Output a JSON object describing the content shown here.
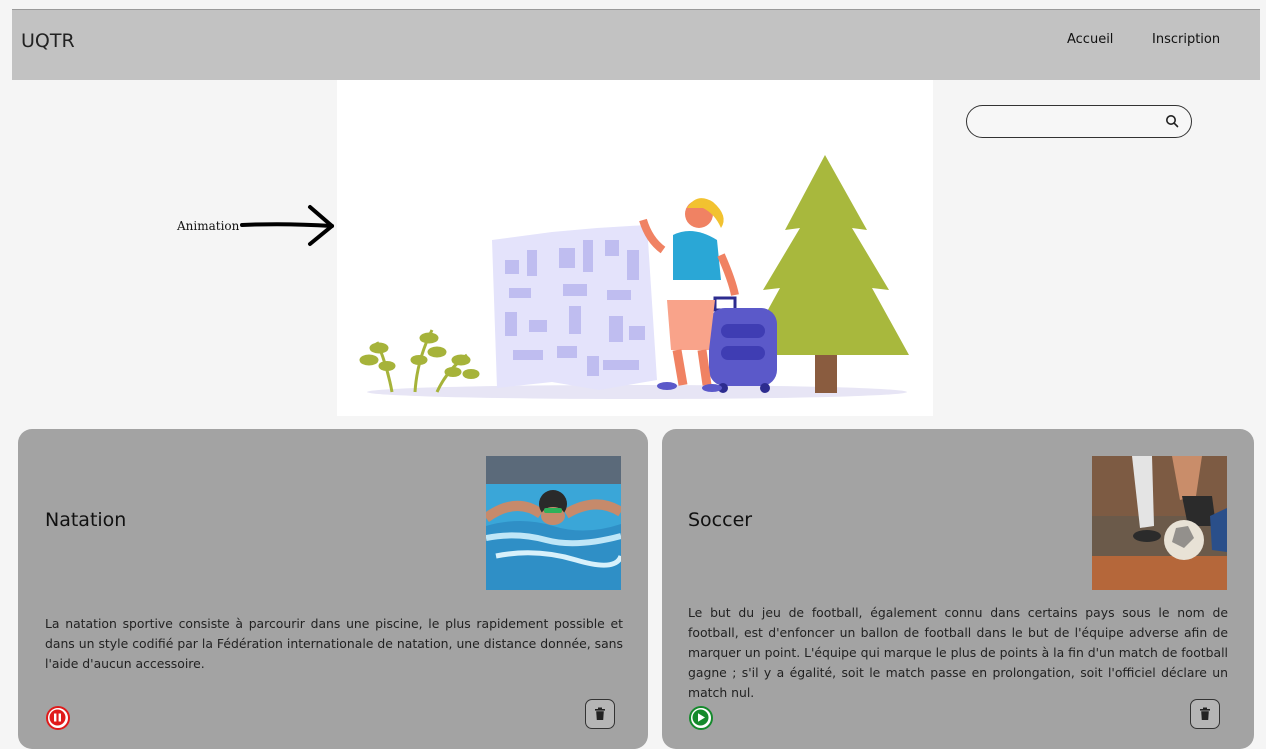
{
  "navbar": {
    "brand": "UQTR",
    "links": [
      "Accueil",
      "Inscription"
    ]
  },
  "annotation": {
    "label": "Animation"
  },
  "search": {
    "value": "",
    "placeholder": ""
  },
  "cards": [
    {
      "title": "Natation",
      "description": "La natation sportive consiste à parcourir dans une piscine, le plus rapidement possible et dans un style codifié par la Fédération internationale de natation, une distance donnée, sans l'aide d'aucun accessoire.",
      "status_icon": "pause-icon",
      "status_color": "#e01b1b"
    },
    {
      "title": "Soccer",
      "description": "Le but du jeu de football, également connu dans certains pays sous le nom de football, est d'enfoncer un ballon de football dans le but de l'équipe adverse afin de marquer un point. L'équipe qui marque le plus de points à la fin d'un match de football gagne ; s'il y a égalité, soit le match passe en prolongation, soit l'officiel déclare un match nul.",
      "status_icon": "play-icon",
      "status_color": "#158a2c"
    }
  ]
}
